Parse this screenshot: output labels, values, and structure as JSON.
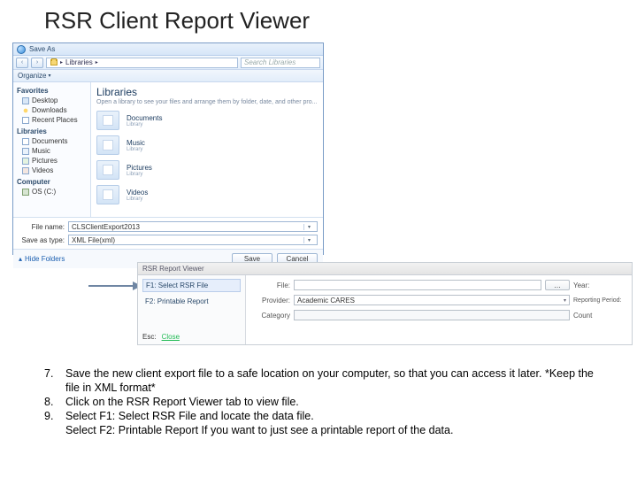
{
  "title": "RSR Client Report Viewer",
  "saveas": {
    "window_title": "Save As",
    "back": "‹",
    "fwd": "›",
    "crumb1": "Libraries",
    "crumb_sep": "▸",
    "search_placeholder": "Search Libraries",
    "organize": "Organize",
    "dd": "▾",
    "fav_header": "Favorites",
    "fav1": "Desktop",
    "fav2": "Downloads",
    "fav3": "Recent Places",
    "lib_header": "Libraries",
    "lib1": "Documents",
    "lib2": "Music",
    "lib3": "Pictures",
    "lib4": "Videos",
    "comp_header": "Computer",
    "comp1": "OS (C:)",
    "main_title": "Libraries",
    "main_sub": "Open a library to see your files and arrange them by folder, date, and other pro...",
    "tile1": "Documents",
    "tile1s": "Library",
    "tile2": "Music",
    "tile2s": "Library",
    "tile3": "Pictures",
    "tile3s": "Library",
    "tile4": "Videos",
    "tile4s": "Library",
    "filename_lbl": "File name:",
    "filename_val": "CLSClientExport2013",
    "savetype_lbl": "Save as type:",
    "savetype_val": "XML File(xml)",
    "hide": "Hide Folders",
    "save": "Save",
    "cancel": "Cancel"
  },
  "rsr": {
    "title": "RSR Report Viewer",
    "step1": "F1: Select RSR File",
    "step2": "F2: Printable Report",
    "file_lbl": "File:",
    "browse": "…",
    "year_lbl": "Year:",
    "provider_lbl": "Provider:",
    "provider_val": "Academic CARES",
    "period_lbl": "Reporting Period:",
    "category_lbl": "Category",
    "count_lbl": "Count",
    "esc": "Esc:",
    "close": "Close"
  },
  "instr": {
    "n7": "7.",
    "t7a": "Save the new client export file to a safe location on your computer, so that you can access it later. *Keep the",
    "t7b": "file in XML format*",
    "n8": "8.",
    "t8": "Click on the RSR Report Viewer tab to view file.",
    "n9": "9.",
    "t9": "Select F1: Select RSR File and locate the data file.",
    "t10": "Select F2: Printable Report If you want to just see a printable report of the data."
  }
}
